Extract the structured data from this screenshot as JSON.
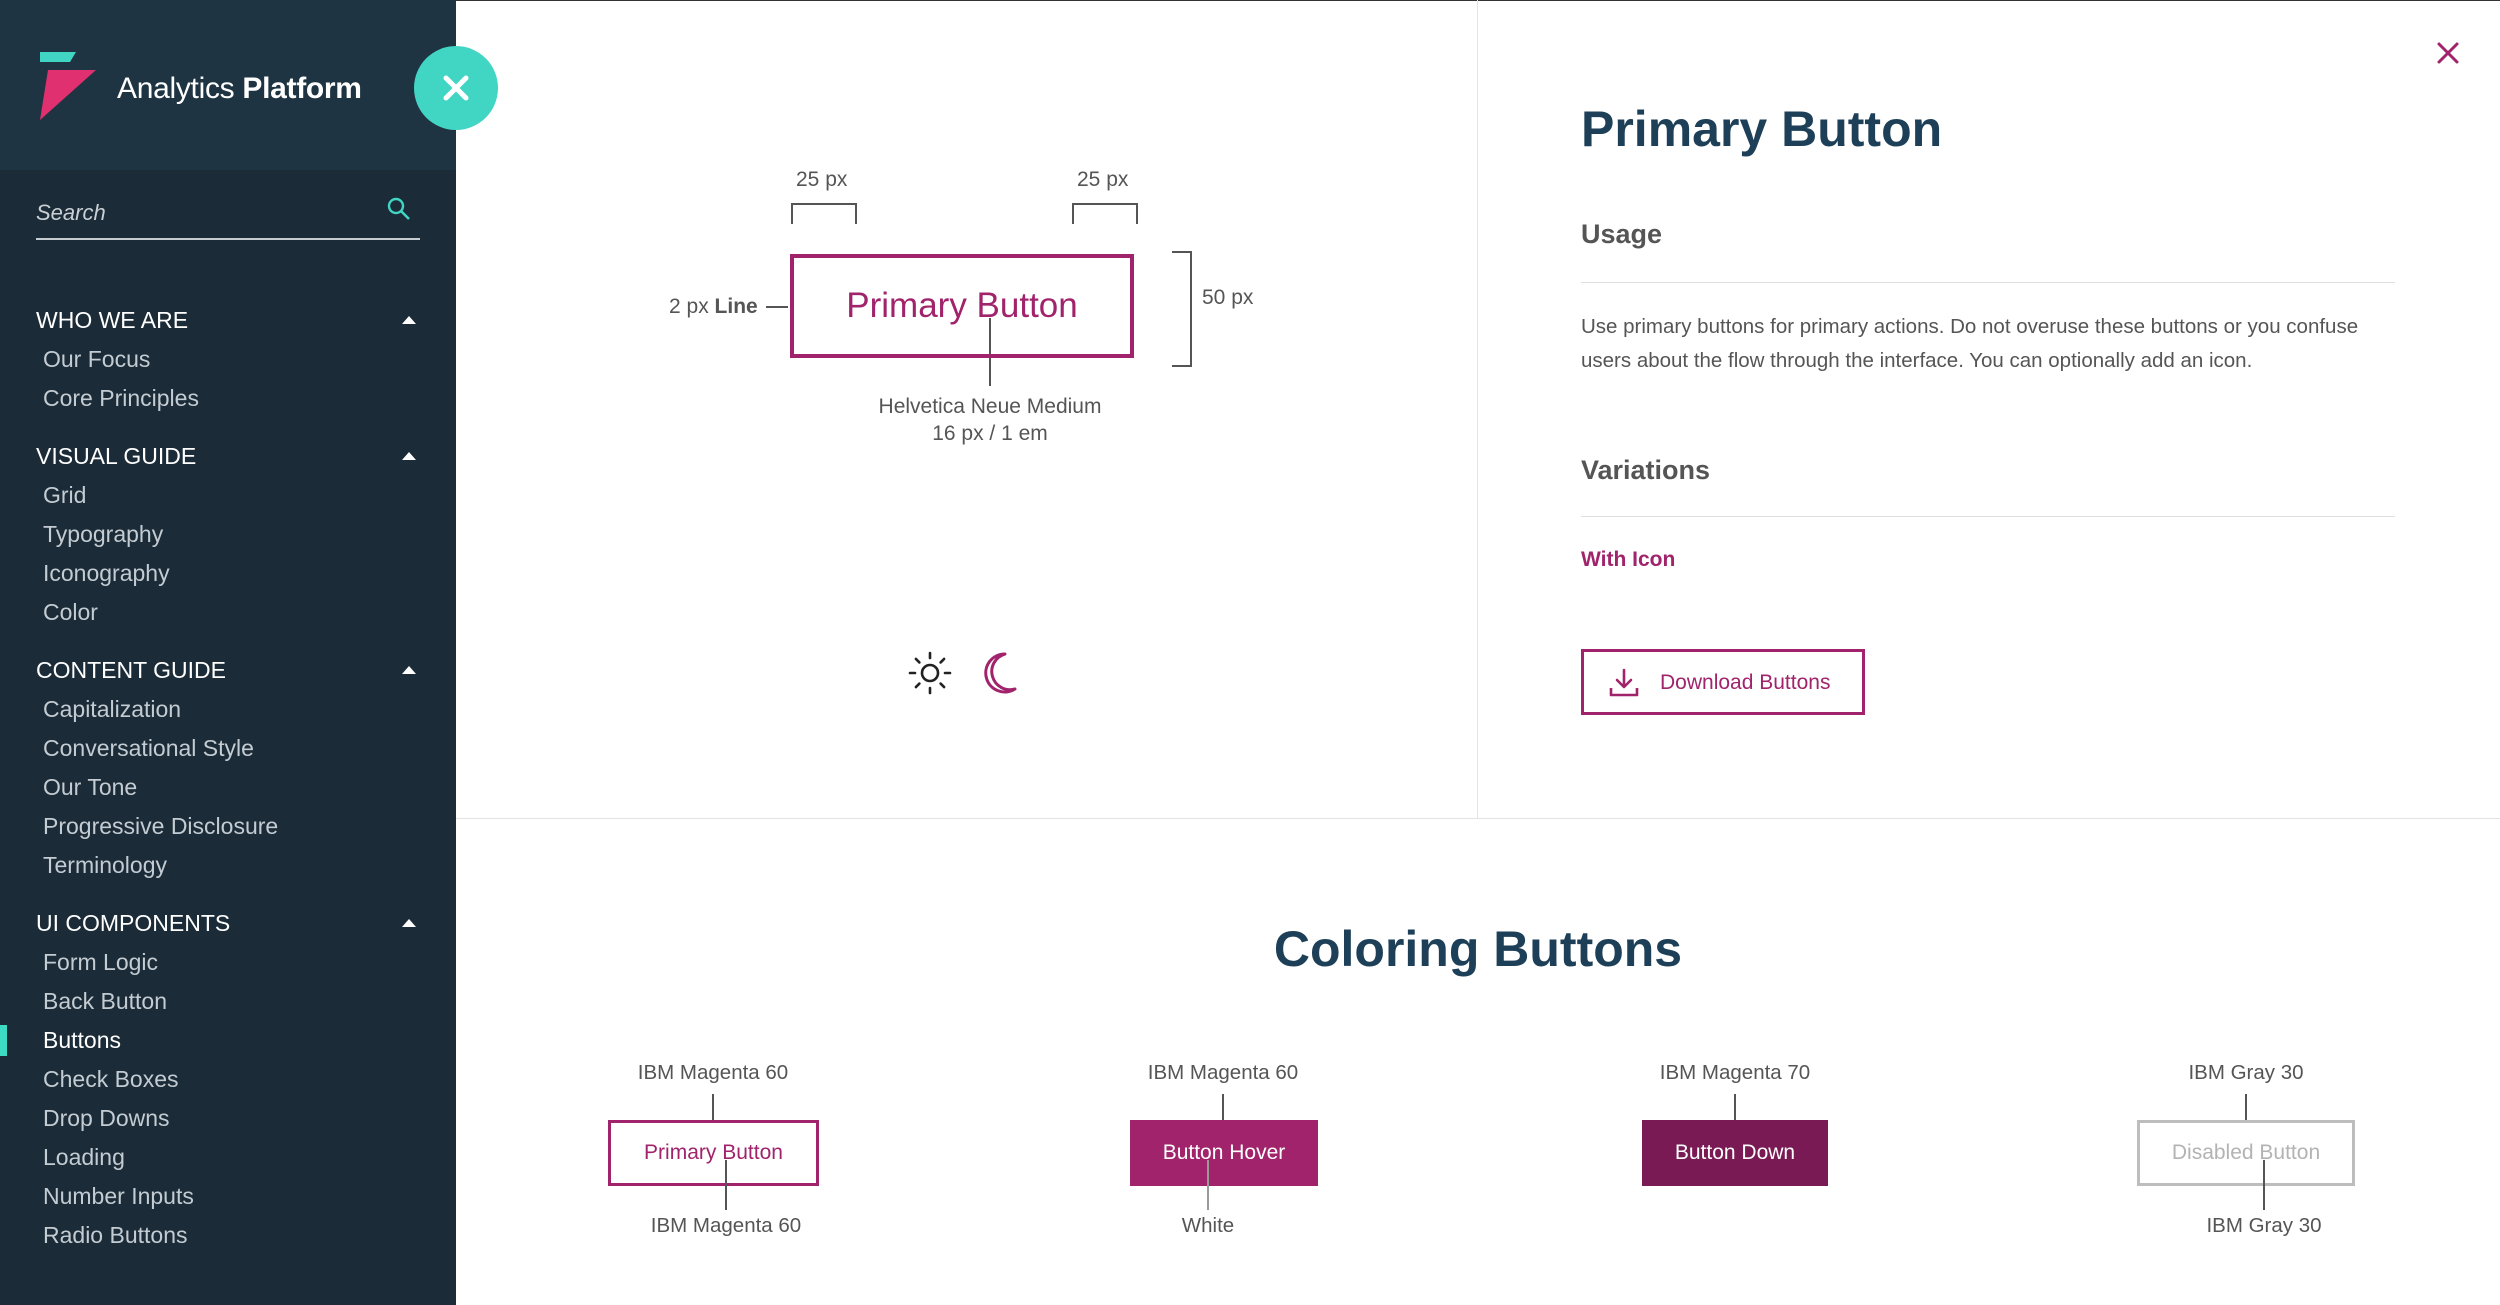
{
  "sidebar": {
    "brand": {
      "light": "Analytics ",
      "bold": "Platform"
    },
    "search": {
      "placeholder": "Search"
    },
    "sections": [
      {
        "title": "WHO WE ARE",
        "items": [
          "Our Focus",
          "Core Principles"
        ]
      },
      {
        "title": "VISUAL GUIDE",
        "items": [
          "Grid",
          "Typography",
          "Iconography",
          "Color"
        ]
      },
      {
        "title": "CONTENT GUIDE",
        "items": [
          "Capitalization",
          "Conversational Style",
          "Our Tone",
          "Progressive Disclosure",
          "Terminology"
        ]
      },
      {
        "title": "UI COMPONENTS",
        "items": [
          "Form Logic",
          "Back Button",
          "Buttons",
          "Check Boxes",
          "Drop Downs",
          "Loading",
          "Number Inputs",
          "Radio Buttons"
        ]
      }
    ],
    "active_item": "Buttons"
  },
  "spec": {
    "padding_left": "25 px",
    "padding_right": "25 px",
    "height": "50 px",
    "line_prefix": "2 px ",
    "line_bold": "Line",
    "button_label": "Primary Button",
    "font_name": "Helvetica Neue Medium",
    "font_size": "16 px / 1 em"
  },
  "detail": {
    "title": "Primary Button",
    "usage_heading": "Usage",
    "usage_text": "Use primary buttons for primary actions. Do not overuse these buttons or you confuse users about the flow through the interface. You can optionally add an icon.",
    "variations_heading": "Variations",
    "with_icon": "With Icon",
    "download_label": "Download Buttons"
  },
  "coloring": {
    "title": "Coloring Buttons",
    "swatches": [
      {
        "top": "IBM Magenta 60",
        "label": "Primary Button",
        "bottom": "IBM Magenta 60"
      },
      {
        "top": "IBM Magenta 60",
        "label": "Button Hover",
        "bottom": "White"
      },
      {
        "top": "IBM Magenta 70",
        "label": "Button Down",
        "bottom": ""
      },
      {
        "top": "IBM Gray 30",
        "label": "Disabled Button",
        "bottom": "IBM Gray 30"
      }
    ]
  },
  "colors": {
    "sidebar_bg": "#1b2b37",
    "accent_teal": "#41d6c3",
    "magenta_60": "#a0236b",
    "magenta_70": "#7a1a55",
    "heading_navy": "#1d3f57",
    "gray_30": "#bdbdbd"
  },
  "icons": [
    "brand-logo",
    "search-icon",
    "close-icon",
    "sun-icon",
    "moon-icon",
    "download-icon",
    "caret-up-icon"
  ]
}
